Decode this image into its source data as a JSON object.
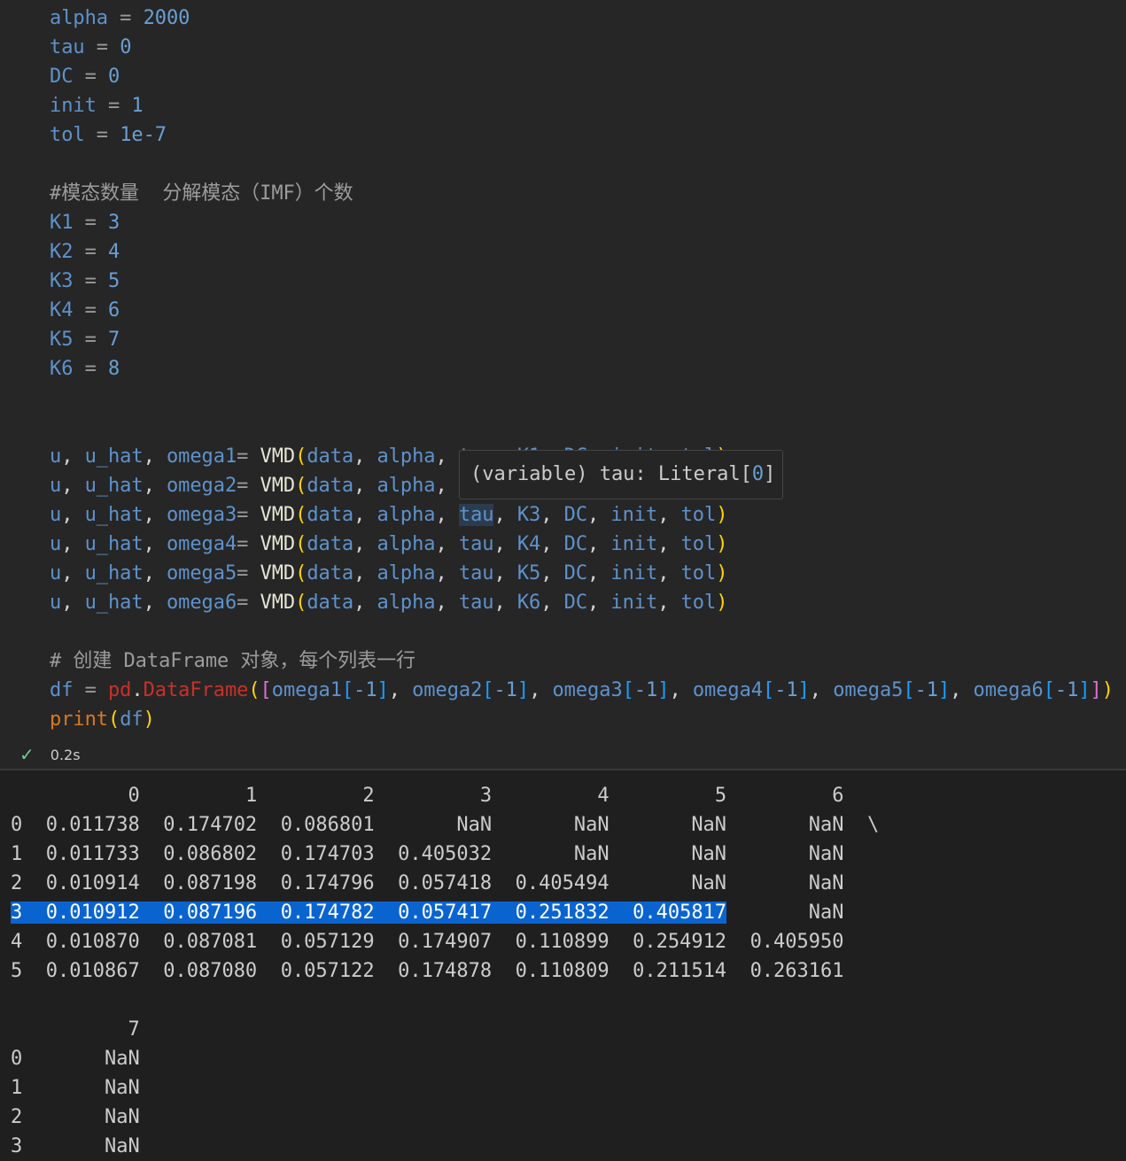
{
  "code_lines": [
    [
      [
        "alpha",
        "v"
      ],
      [
        " = ",
        "o"
      ],
      [
        "2000",
        "n"
      ]
    ],
    [
      [
        "tau",
        "v"
      ],
      [
        " = ",
        "o"
      ],
      [
        "0",
        "n"
      ]
    ],
    [
      [
        "DC",
        "v"
      ],
      [
        " = ",
        "o"
      ],
      [
        "0",
        "n"
      ]
    ],
    [
      [
        "init",
        "v"
      ],
      [
        " = ",
        "o"
      ],
      [
        "1",
        "n"
      ]
    ],
    [
      [
        "tol",
        "v"
      ],
      [
        " = ",
        "o"
      ],
      [
        "1e-7",
        "n"
      ]
    ],
    [],
    [
      [
        "#模态数量  分解模态（IMF）个数",
        "c"
      ]
    ],
    [
      [
        "K1",
        "v"
      ],
      [
        " = ",
        "o"
      ],
      [
        "3",
        "n"
      ]
    ],
    [
      [
        "K2",
        "v"
      ],
      [
        " = ",
        "o"
      ],
      [
        "4",
        "n"
      ]
    ],
    [
      [
        "K3",
        "v"
      ],
      [
        " = ",
        "o"
      ],
      [
        "5",
        "n"
      ]
    ],
    [
      [
        "K4",
        "v"
      ],
      [
        " = ",
        "o"
      ],
      [
        "6",
        "n"
      ]
    ],
    [
      [
        "K5",
        "v"
      ],
      [
        " = ",
        "o"
      ],
      [
        "7",
        "n"
      ]
    ],
    [
      [
        "K6",
        "v"
      ],
      [
        " = ",
        "o"
      ],
      [
        "8",
        "n"
      ]
    ],
    [],
    [],
    [
      [
        "u",
        "v"
      ],
      [
        ", ",
        "w"
      ],
      [
        "u_hat",
        "v"
      ],
      [
        ", ",
        "w"
      ],
      [
        "omega1",
        "v"
      ],
      [
        "= ",
        "o"
      ],
      [
        "VMD",
        "f"
      ],
      [
        "(",
        "p1"
      ],
      [
        "data",
        "v"
      ],
      [
        ", ",
        "w"
      ],
      [
        "alpha",
        "v"
      ],
      [
        ", ",
        "w"
      ],
      [
        "tau",
        "v"
      ],
      [
        ", ",
        "w"
      ],
      [
        "K1",
        "v"
      ],
      [
        ", ",
        "w"
      ],
      [
        "DC",
        "v"
      ],
      [
        ", ",
        "w"
      ],
      [
        "init",
        "v"
      ],
      [
        ", ",
        "w"
      ],
      [
        "tol",
        "v"
      ],
      [
        ")",
        "p1"
      ]
    ],
    [
      [
        "u",
        "v"
      ],
      [
        ", ",
        "w"
      ],
      [
        "u_hat",
        "v"
      ],
      [
        ", ",
        "w"
      ],
      [
        "omega2",
        "v"
      ],
      [
        "= ",
        "o"
      ],
      [
        "VMD",
        "f"
      ],
      [
        "(",
        "p1"
      ],
      [
        "data",
        "v"
      ],
      [
        ", ",
        "w"
      ],
      [
        "alpha",
        "v"
      ],
      [
        ", ",
        "w"
      ],
      [
        "tau",
        "v"
      ],
      [
        ", ",
        "w"
      ],
      [
        "K2",
        "v"
      ],
      [
        ", ",
        "w"
      ],
      [
        "DC",
        "v"
      ],
      [
        ", ",
        "w"
      ],
      [
        "init",
        "v"
      ],
      [
        ", ",
        "w"
      ],
      [
        "tol",
        "v"
      ],
      [
        ")",
        "p1"
      ]
    ],
    [
      [
        "u",
        "v"
      ],
      [
        ", ",
        "w"
      ],
      [
        "u_hat",
        "v"
      ],
      [
        ", ",
        "w"
      ],
      [
        "omega3",
        "v"
      ],
      [
        "= ",
        "o"
      ],
      [
        "VMD",
        "f"
      ],
      [
        "(",
        "p1"
      ],
      [
        "data",
        "v"
      ],
      [
        ", ",
        "w"
      ],
      [
        "alpha",
        "v"
      ],
      [
        ", ",
        "w"
      ],
      [
        "tau",
        "v tauhl"
      ],
      [
        ", ",
        "w"
      ],
      [
        "K3",
        "v"
      ],
      [
        ", ",
        "w"
      ],
      [
        "DC",
        "v"
      ],
      [
        ", ",
        "w"
      ],
      [
        "init",
        "v"
      ],
      [
        ", ",
        "w"
      ],
      [
        "tol",
        "v"
      ],
      [
        ")",
        "p1"
      ]
    ],
    [
      [
        "u",
        "v"
      ],
      [
        ", ",
        "w"
      ],
      [
        "u_hat",
        "v"
      ],
      [
        ", ",
        "w"
      ],
      [
        "omega4",
        "v"
      ],
      [
        "= ",
        "o"
      ],
      [
        "VMD",
        "f"
      ],
      [
        "(",
        "p1"
      ],
      [
        "data",
        "v"
      ],
      [
        ", ",
        "w"
      ],
      [
        "alpha",
        "v"
      ],
      [
        ", ",
        "w"
      ],
      [
        "tau",
        "v"
      ],
      [
        ", ",
        "w"
      ],
      [
        "K4",
        "v"
      ],
      [
        ", ",
        "w"
      ],
      [
        "DC",
        "v"
      ],
      [
        ", ",
        "w"
      ],
      [
        "init",
        "v"
      ],
      [
        ", ",
        "w"
      ],
      [
        "tol",
        "v"
      ],
      [
        ")",
        "p1"
      ]
    ],
    [
      [
        "u",
        "v"
      ],
      [
        ", ",
        "w"
      ],
      [
        "u_hat",
        "v"
      ],
      [
        ", ",
        "w"
      ],
      [
        "omega5",
        "v"
      ],
      [
        "= ",
        "o"
      ],
      [
        "VMD",
        "f"
      ],
      [
        "(",
        "p1"
      ],
      [
        "data",
        "v"
      ],
      [
        ", ",
        "w"
      ],
      [
        "alpha",
        "v"
      ],
      [
        ", ",
        "w"
      ],
      [
        "tau",
        "v"
      ],
      [
        ", ",
        "w"
      ],
      [
        "K5",
        "v"
      ],
      [
        ", ",
        "w"
      ],
      [
        "DC",
        "v"
      ],
      [
        ", ",
        "w"
      ],
      [
        "init",
        "v"
      ],
      [
        ", ",
        "w"
      ],
      [
        "tol",
        "v"
      ],
      [
        ")",
        "p1"
      ]
    ],
    [
      [
        "u",
        "v"
      ],
      [
        ", ",
        "w"
      ],
      [
        "u_hat",
        "v"
      ],
      [
        ", ",
        "w"
      ],
      [
        "omega6",
        "v"
      ],
      [
        "= ",
        "o"
      ],
      [
        "VMD",
        "f"
      ],
      [
        "(",
        "p1"
      ],
      [
        "data",
        "v"
      ],
      [
        ", ",
        "w"
      ],
      [
        "alpha",
        "v"
      ],
      [
        ", ",
        "w"
      ],
      [
        "tau",
        "v"
      ],
      [
        ", ",
        "w"
      ],
      [
        "K6",
        "v"
      ],
      [
        ", ",
        "w"
      ],
      [
        "DC",
        "v"
      ],
      [
        ", ",
        "w"
      ],
      [
        "init",
        "v"
      ],
      [
        ", ",
        "w"
      ],
      [
        "tol",
        "v"
      ],
      [
        ")",
        "p1"
      ]
    ],
    [],
    [
      [
        "# 创建 DataFrame 对象，每个列表一行",
        "c"
      ]
    ],
    [
      [
        "df",
        "v"
      ],
      [
        " = ",
        "o"
      ],
      [
        "pd",
        "r"
      ],
      [
        ".",
        "w"
      ],
      [
        "DataFrame",
        "r"
      ],
      [
        "(",
        "p1"
      ],
      [
        "[",
        "p2"
      ],
      [
        "omega1",
        "v"
      ],
      [
        "[",
        "p3"
      ],
      [
        "-1",
        "n"
      ],
      [
        "]",
        "p3"
      ],
      [
        ", ",
        "w"
      ],
      [
        "omega2",
        "v"
      ],
      [
        "[",
        "p3"
      ],
      [
        "-1",
        "n"
      ],
      [
        "]",
        "p3"
      ],
      [
        ", ",
        "w"
      ],
      [
        "omega3",
        "v"
      ],
      [
        "[",
        "p3"
      ],
      [
        "-1",
        "n"
      ],
      [
        "]",
        "p3"
      ],
      [
        ", ",
        "w"
      ],
      [
        "omega4",
        "v"
      ],
      [
        "[",
        "p3"
      ],
      [
        "-1",
        "n"
      ],
      [
        "]",
        "p3"
      ],
      [
        ", ",
        "w"
      ],
      [
        "omega5",
        "v"
      ],
      [
        "[",
        "p3"
      ],
      [
        "-1",
        "n"
      ],
      [
        "]",
        "p3"
      ],
      [
        ", ",
        "w"
      ],
      [
        "omega6",
        "v"
      ],
      [
        "[",
        "p3"
      ],
      [
        "-1",
        "n"
      ],
      [
        "]",
        "p3"
      ],
      [
        "]",
        "p2"
      ],
      [
        ")",
        "p1"
      ]
    ],
    [
      [
        "print",
        "pr"
      ],
      [
        "(",
        "p1"
      ],
      [
        "df",
        "v"
      ],
      [
        ")",
        "p1"
      ]
    ]
  ],
  "tooltip": {
    "prefix": "(variable) tau: Literal[",
    "value": "0",
    "suffix": "]"
  },
  "status": {
    "icon": "check-icon",
    "duration": "0.2s"
  },
  "output": {
    "header1": [
      "0",
      "1",
      "2",
      "3",
      "4",
      "5",
      "6"
    ],
    "rows1": [
      {
        "index": "0",
        "values": [
          "0.011738",
          "0.174702",
          "0.086801",
          "NaN",
          "NaN",
          "NaN",
          "NaN"
        ],
        "continuation": "\\"
      },
      {
        "index": "1",
        "values": [
          "0.011733",
          "0.086802",
          "0.174703",
          "0.405032",
          "NaN",
          "NaN",
          "NaN"
        ]
      },
      {
        "index": "2",
        "values": [
          "0.010914",
          "0.087198",
          "0.174796",
          "0.057418",
          "0.405494",
          "NaN",
          "NaN"
        ]
      },
      {
        "index": "3",
        "values": [
          "0.010912",
          "0.087196",
          "0.174782",
          "0.057417",
          "0.251832",
          "0.405817",
          "NaN"
        ],
        "selected": true
      },
      {
        "index": "4",
        "values": [
          "0.010870",
          "0.087081",
          "0.057129",
          "0.174907",
          "0.110899",
          "0.254912",
          "0.405950"
        ]
      },
      {
        "index": "5",
        "values": [
          "0.010867",
          "0.087080",
          "0.057122",
          "0.174878",
          "0.110809",
          "0.211514",
          "0.263161"
        ]
      }
    ],
    "header2": [
      "7"
    ],
    "rows2": [
      {
        "index": "0",
        "values": [
          "NaN"
        ]
      },
      {
        "index": "1",
        "values": [
          "NaN"
        ]
      },
      {
        "index": "2",
        "values": [
          "NaN"
        ]
      },
      {
        "index": "3",
        "values": [
          "NaN"
        ]
      }
    ]
  },
  "colors": {
    "selection": "#0a64d0",
    "check": "#73c991",
    "variable": "#5e92cc",
    "background": "#262626"
  }
}
